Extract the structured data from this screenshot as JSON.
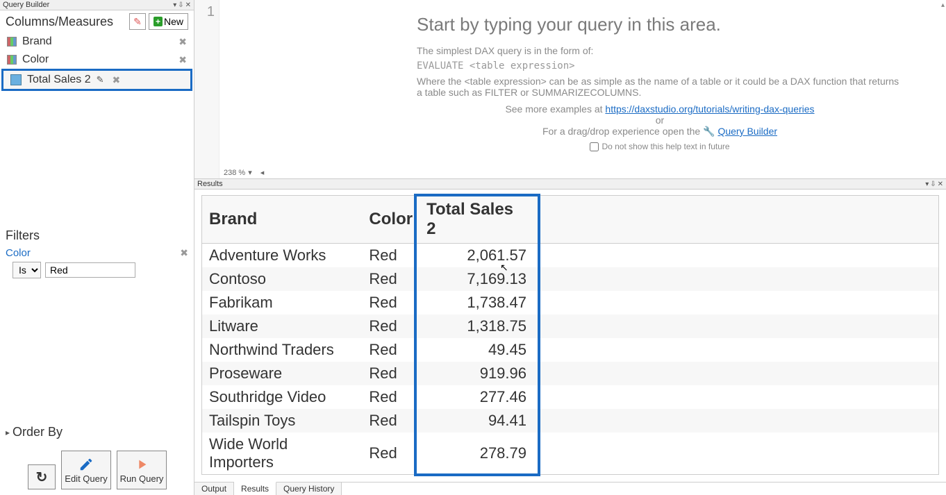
{
  "left": {
    "panel_title": "Query Builder",
    "section_title": "Columns/Measures",
    "new_button": "New",
    "measures": [
      {
        "label": "Brand"
      },
      {
        "label": "Color"
      },
      {
        "label": "Total Sales 2"
      }
    ],
    "filters_title": "Filters",
    "filter_name": "Color",
    "filter_op": "Is",
    "filter_value": "Red",
    "order_by_title": "Order By",
    "edit_query": "Edit Query",
    "run_query": "Run Query"
  },
  "editor": {
    "line1": "1",
    "help_title": "Start by typing your query in this area.",
    "help_line1": "The simplest DAX query is in the form of:",
    "help_code": "EVALUATE <table expression>",
    "help_line2": "Where the <table expression> can be as simple as the name of a table or it could be a DAX function that returns a table such as FILTER or SUMMARIZECOLUMNS.",
    "help_examples_prefix": "See more examples at ",
    "help_examples_link": "https://daxstudio.org/tutorials/writing-dax-queries",
    "help_or": "or",
    "help_dragdrop": "For a drag/drop experience open the ",
    "help_qb_link": "Query Builder",
    "do_not_show": "Do not show this help text in future",
    "zoom": "238 %"
  },
  "results": {
    "header": "Results",
    "columns": [
      "Brand",
      "Color",
      "Total Sales 2"
    ],
    "rows": [
      {
        "brand": "Adventure Works",
        "color": "Red",
        "total": "2,061.57"
      },
      {
        "brand": "Contoso",
        "color": "Red",
        "total": "7,169.13"
      },
      {
        "brand": "Fabrikam",
        "color": "Red",
        "total": "1,738.47"
      },
      {
        "brand": "Litware",
        "color": "Red",
        "total": "1,318.75"
      },
      {
        "brand": "Northwind Traders",
        "color": "Red",
        "total": "49.45"
      },
      {
        "brand": "Proseware",
        "color": "Red",
        "total": "919.96"
      },
      {
        "brand": "Southridge Video",
        "color": "Red",
        "total": "277.46"
      },
      {
        "brand": "Tailspin Toys",
        "color": "Red",
        "total": "94.41"
      },
      {
        "brand": "Wide World Importers",
        "color": "Red",
        "total": "278.79"
      }
    ]
  },
  "tabs": {
    "output": "Output",
    "results": "Results",
    "history": "Query History"
  }
}
